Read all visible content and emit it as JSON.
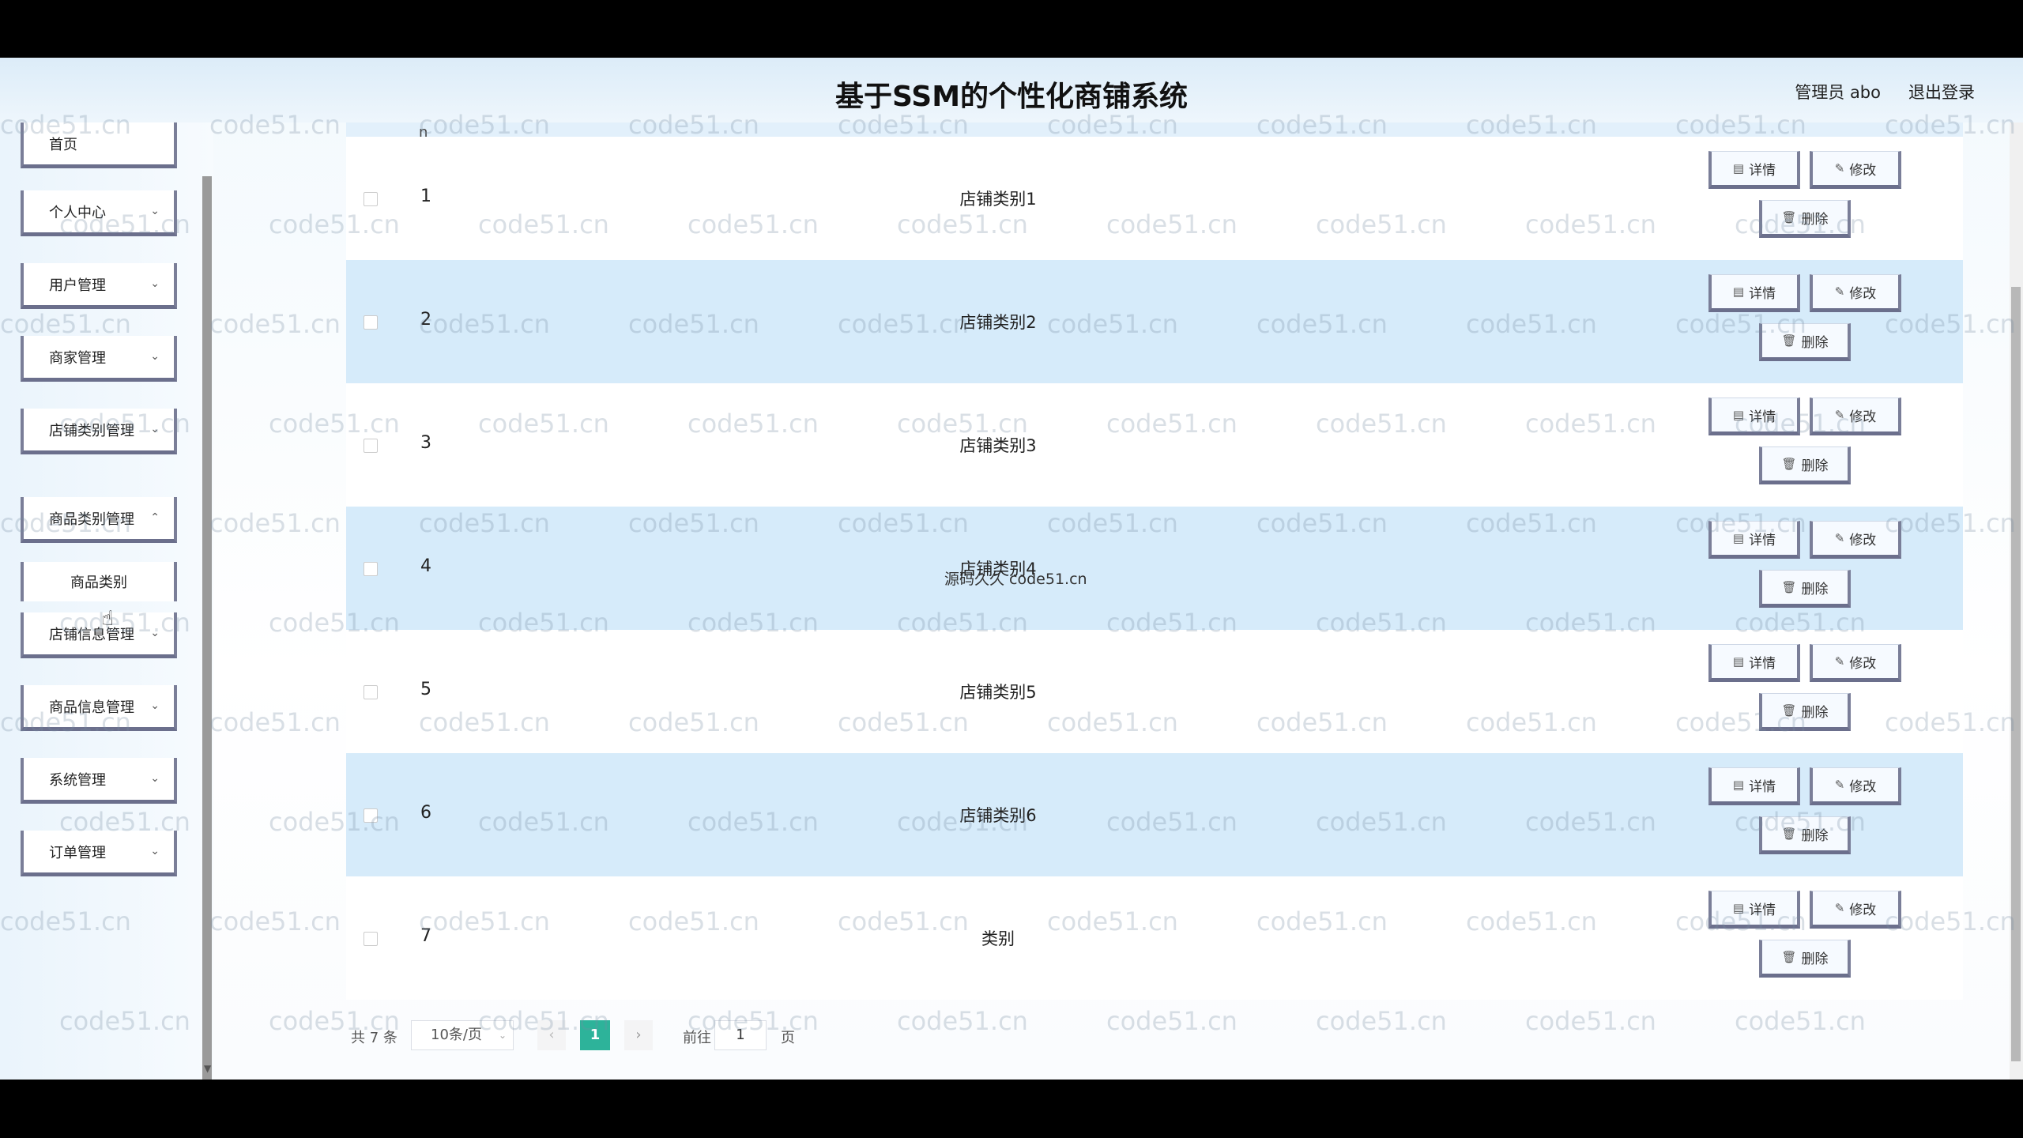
{
  "header": {
    "title": "基于SSM的个性化商铺系统",
    "user_label": "管理员 abo",
    "logout_label": "退出登录"
  },
  "sidebar": {
    "items": [
      {
        "label": "首页",
        "has_submenu": false
      },
      {
        "label": "个人中心",
        "has_submenu": true
      },
      {
        "label": "用户管理",
        "has_submenu": true
      },
      {
        "label": "商家管理",
        "has_submenu": true
      },
      {
        "label": "店铺类别管理",
        "has_submenu": true
      },
      {
        "label": "商品类别管理",
        "has_submenu": true,
        "expanded": true
      },
      {
        "label": "店铺信息管理",
        "has_submenu": true
      },
      {
        "label": "商品信息管理",
        "has_submenu": true
      },
      {
        "label": "系统管理",
        "has_submenu": true
      },
      {
        "label": "订单管理",
        "has_submenu": true
      }
    ],
    "subitem": "商品类别",
    "chevron_icon": "chevron-down-icon"
  },
  "table": {
    "header_partial": "n",
    "rows": [
      {
        "index": "1",
        "name": "店铺类别1"
      },
      {
        "index": "2",
        "name": "店铺类别2"
      },
      {
        "index": "3",
        "name": "店铺类别3"
      },
      {
        "index": "4",
        "name": "店铺类别4"
      },
      {
        "index": "5",
        "name": "店铺类别5"
      },
      {
        "index": "6",
        "name": "店铺类别6"
      },
      {
        "index": "7",
        "name": "类别"
      }
    ],
    "actions": {
      "detail": "详情",
      "edit": "修改",
      "delete": "删除"
    },
    "overlay_text": "源码久久 code51.cn"
  },
  "pagination": {
    "total": "共 7 条",
    "page_size": "10条/页",
    "current_page": "1",
    "goto_label": "前往",
    "goto_value": "1",
    "goto_unit": "页"
  },
  "watermark": "code51.cn",
  "colors": {
    "accent": "#2db39a",
    "row_alt": "#d6ebfa",
    "button_border": "#6b6f8c"
  }
}
